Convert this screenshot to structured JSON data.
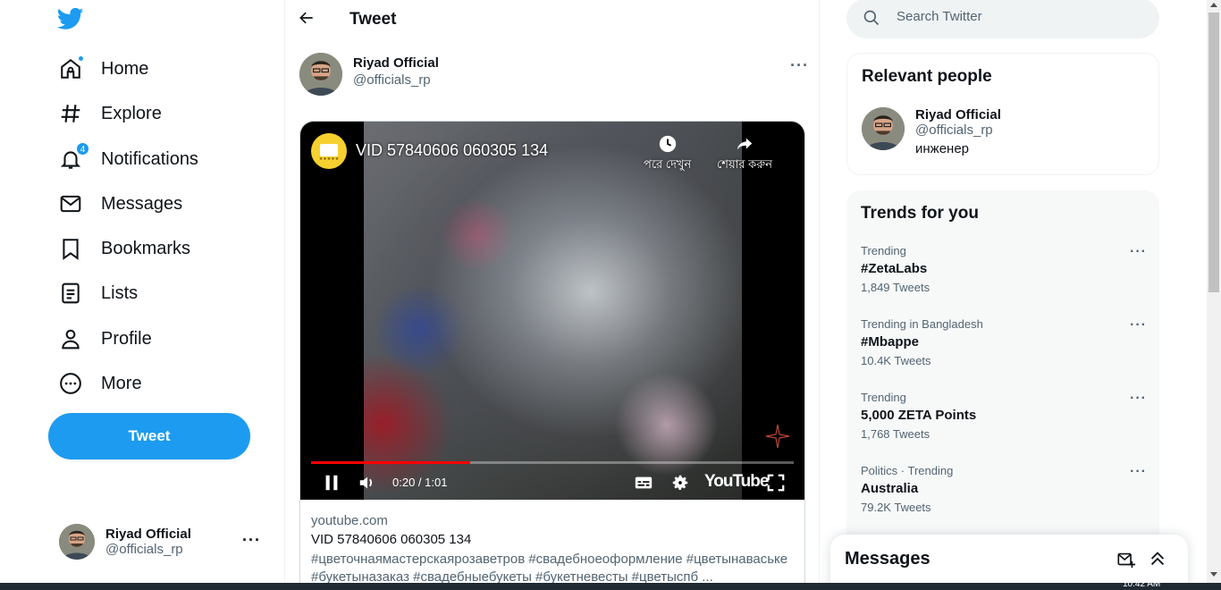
{
  "nav": {
    "items": [
      {
        "label": "Home",
        "icon": "home-icon"
      },
      {
        "label": "Explore",
        "icon": "hashtag-icon"
      },
      {
        "label": "Notifications",
        "icon": "bell-icon",
        "badge": "4"
      },
      {
        "label": "Messages",
        "icon": "envelope-icon"
      },
      {
        "label": "Bookmarks",
        "icon": "bookmark-icon"
      },
      {
        "label": "Lists",
        "icon": "list-icon"
      },
      {
        "label": "Profile",
        "icon": "person-icon"
      },
      {
        "label": "More",
        "icon": "more-circle-icon"
      }
    ],
    "tweet_button": "Tweet",
    "account": {
      "name": "Riyad Official",
      "handle": "@officials_rp"
    }
  },
  "header": {
    "title": "Tweet"
  },
  "tweet": {
    "author": {
      "name": "Riyad Official",
      "handle": "@officials_rp"
    },
    "card": {
      "video": {
        "title": "VID 57840606 060305 134",
        "watch_later": "পরে দেখুন",
        "share": "শেয়ার করুন",
        "time": "0:20 / 1:01",
        "progress": 0.33,
        "platform": "YouTube"
      },
      "domain": "youtube.com",
      "title": "VID 57840606 060305 134",
      "description": "#цветочнаямастерскаярозаветров #свадебноеоформление #цветынаваське #букетыназаказ #свадебныебукеты #букетневесты #цветыспб ..."
    }
  },
  "search": {
    "placeholder": "Search Twitter"
  },
  "relevant": {
    "title": "Relevant people",
    "person": {
      "name": "Riyad Official",
      "handle": "@officials_rp",
      "bio": "инженер"
    }
  },
  "trends": {
    "title": "Trends for you",
    "items": [
      {
        "context": "Trending",
        "topic": "#ZetaLabs",
        "count": "1,849 Tweets"
      },
      {
        "context": "Trending in Bangladesh",
        "topic": "#Mbappe",
        "count": "10.4K Tweets"
      },
      {
        "context": "Trending",
        "topic": "5,000 ZETA Points",
        "count": "1,768 Tweets"
      },
      {
        "context": "Politics · Trending",
        "topic": "Australia",
        "count": "79.2K Tweets"
      }
    ]
  },
  "messages_drawer": {
    "title": "Messages"
  },
  "taskbar": {
    "clock": "10:42 AM"
  },
  "colors": {
    "accent": "#1d9bf0",
    "text": "#0f1419",
    "muted": "#536471",
    "progress": "#ff0000"
  }
}
